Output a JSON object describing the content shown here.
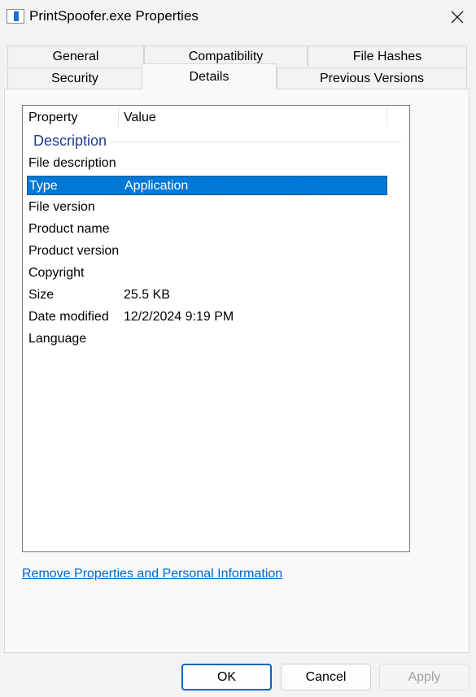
{
  "window": {
    "title": "PrintSpoofer.exe Properties",
    "icon": "file-properties-icon",
    "close_icon": "close-icon"
  },
  "tabs": {
    "row_top": [
      "General",
      "Compatibility",
      "File Hashes"
    ],
    "row_bottom": [
      "Security",
      "Details",
      "Previous Versions"
    ],
    "active": "Details"
  },
  "details": {
    "columns": {
      "property": "Property",
      "value": "Value"
    },
    "group": "Description",
    "rows": [
      {
        "property": "File description",
        "value": ""
      },
      {
        "property": "Type",
        "value": "Application",
        "selected": true
      },
      {
        "property": "File version",
        "value": ""
      },
      {
        "property": "Product name",
        "value": ""
      },
      {
        "property": "Product version",
        "value": ""
      },
      {
        "property": "Copyright",
        "value": ""
      },
      {
        "property": "Size",
        "value": "25.5 KB"
      },
      {
        "property": "Date modified",
        "value": "12/2/2024 9:19 PM"
      },
      {
        "property": "Language",
        "value": ""
      }
    ],
    "remove_link": "Remove Properties and Personal Information"
  },
  "buttons": {
    "ok": "OK",
    "cancel": "Cancel",
    "apply": "Apply"
  },
  "colors": {
    "selection": "#0078d7",
    "group_header": "#1e3e8c",
    "link": "#0066cc",
    "primary_border": "#0067c0"
  }
}
